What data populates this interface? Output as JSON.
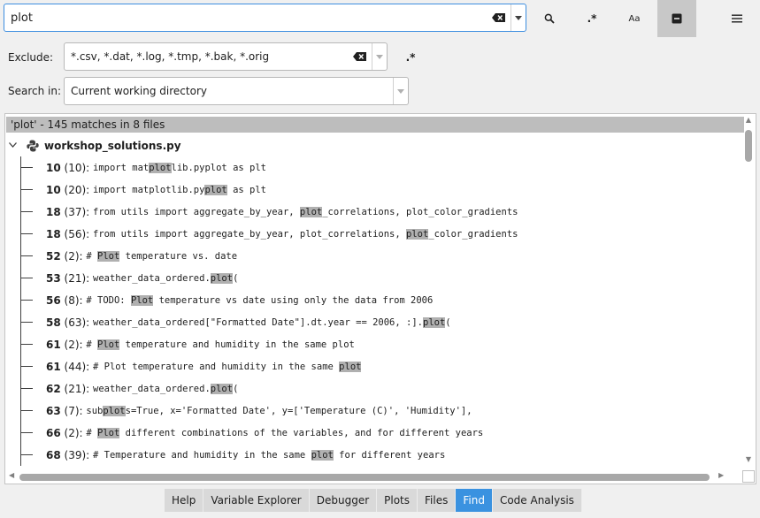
{
  "search": {
    "query": "plot"
  },
  "toolbar": {
    "regex_glyph": ".*",
    "case_glyph": "Aa"
  },
  "exclude": {
    "label": "Exclude:",
    "value": "*.csv, *.dat, *.log, *.tmp, *.bak, *.orig",
    "regex_glyph": ".*"
  },
  "search_in": {
    "label": "Search in:",
    "value": "Current working directory"
  },
  "results": {
    "summary": "'plot' - 145 matches in 8 files",
    "file": "workshop_solutions.py",
    "matches": [
      {
        "line": "10",
        "col": "(10):",
        "parts": [
          [
            "import mat",
            false
          ],
          [
            "plot",
            true
          ],
          [
            "lib.pyplot as plt",
            false
          ]
        ]
      },
      {
        "line": "10",
        "col": "(20):",
        "parts": [
          [
            "import matplotlib.py",
            false
          ],
          [
            "plot",
            true
          ],
          [
            " as plt",
            false
          ]
        ]
      },
      {
        "line": "18",
        "col": "(37):",
        "parts": [
          [
            "from utils import aggregate_by_year, ",
            false
          ],
          [
            "plot",
            true
          ],
          [
            "_correlations, plot_color_gradients",
            false
          ]
        ]
      },
      {
        "line": "18",
        "col": "(56):",
        "parts": [
          [
            "from utils import aggregate_by_year, plot_correlations, ",
            false
          ],
          [
            "plot",
            true
          ],
          [
            "_color_gradients",
            false
          ]
        ]
      },
      {
        "line": "52",
        "col": "(2):",
        "parts": [
          [
            "# ",
            false
          ],
          [
            "Plot",
            true
          ],
          [
            " temperature vs. date",
            false
          ]
        ]
      },
      {
        "line": "53",
        "col": "(21):",
        "parts": [
          [
            "weather_data_ordered.",
            false
          ],
          [
            "plot",
            true
          ],
          [
            "(",
            false
          ]
        ]
      },
      {
        "line": "56",
        "col": "(8):",
        "parts": [
          [
            "# TODO: ",
            false
          ],
          [
            "Plot",
            true
          ],
          [
            " temperature vs date using only the data from 2006",
            false
          ]
        ]
      },
      {
        "line": "58",
        "col": "(63):",
        "parts": [
          [
            "weather_data_ordered[\"Formatted Date\"].dt.year == 2006, :].",
            false
          ],
          [
            "plot",
            true
          ],
          [
            "(",
            false
          ]
        ]
      },
      {
        "line": "61",
        "col": "(2):",
        "parts": [
          [
            "# ",
            false
          ],
          [
            "Plot",
            true
          ],
          [
            " temperature and humidity in the same plot",
            false
          ]
        ]
      },
      {
        "line": "61",
        "col": "(44):",
        "parts": [
          [
            "# Plot temperature and humidity in the same ",
            false
          ],
          [
            "plot",
            true
          ]
        ]
      },
      {
        "line": "62",
        "col": "(21):",
        "parts": [
          [
            "weather_data_ordered.",
            false
          ],
          [
            "plot",
            true
          ],
          [
            "(",
            false
          ]
        ]
      },
      {
        "line": "63",
        "col": "(7):",
        "parts": [
          [
            "sub",
            false
          ],
          [
            "plot",
            true
          ],
          [
            "s=True, x='Formatted Date', y=['Temperature (C)', 'Humidity'],",
            false
          ]
        ]
      },
      {
        "line": "66",
        "col": "(2):",
        "parts": [
          [
            "# ",
            false
          ],
          [
            "Plot",
            true
          ],
          [
            " different combinations of the variables, and for different years",
            false
          ]
        ]
      },
      {
        "line": "68",
        "col": "(39):",
        "parts": [
          [
            "# Temperature and humidity in the same ",
            false
          ],
          [
            "plot",
            true
          ],
          [
            " for different years",
            false
          ]
        ]
      }
    ]
  },
  "tabs": [
    {
      "label": "Help",
      "active": false
    },
    {
      "label": "Variable Explorer",
      "active": false
    },
    {
      "label": "Debugger",
      "active": false
    },
    {
      "label": "Plots",
      "active": false
    },
    {
      "label": "Files",
      "active": false
    },
    {
      "label": "Find",
      "active": true
    },
    {
      "label": "Code Analysis",
      "active": false
    }
  ],
  "colors": {
    "accent": "#3a92e0",
    "highlight": "#b0b0b0"
  }
}
